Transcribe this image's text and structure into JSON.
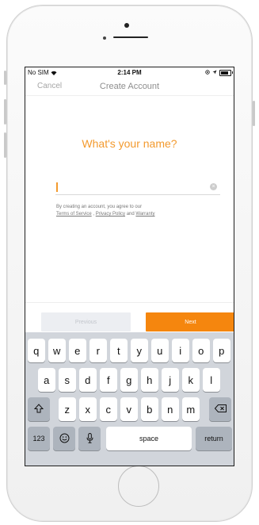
{
  "status_bar": {
    "carrier": "No SIM",
    "time": "2:14 PM"
  },
  "nav": {
    "cancel_label": "Cancel",
    "title": "Create Account"
  },
  "form": {
    "question": "What's your name?",
    "name_value": "",
    "legal_prefix": "By creating an account, you agree to our",
    "terms_link": "Terms of Service",
    "privacy_link": "Privacy Policy",
    "and_text": "and",
    "warranty_link": "Warranty"
  },
  "buttons": {
    "previous_label": "Previous",
    "next_label": "Next"
  },
  "keyboard": {
    "row1": [
      "q",
      "w",
      "e",
      "r",
      "t",
      "y",
      "u",
      "i",
      "o",
      "p"
    ],
    "row2": [
      "a",
      "s",
      "d",
      "f",
      "g",
      "h",
      "j",
      "k",
      "l"
    ],
    "row3": [
      "z",
      "x",
      "c",
      "v",
      "b",
      "n",
      "m"
    ],
    "numbers_label": "123",
    "space_label": "space",
    "return_label": "return"
  },
  "colors": {
    "accent": "#f5860e",
    "question_text": "#f39a2e",
    "keyboard_bg": "#d1d5db"
  },
  "icons": {
    "wifi": "wifi-icon",
    "battery": "battery-icon",
    "clear": "clear-text-icon",
    "shift": "shift-icon",
    "backspace": "backspace-icon",
    "emoji": "emoji-icon",
    "mic": "microphone-icon"
  }
}
